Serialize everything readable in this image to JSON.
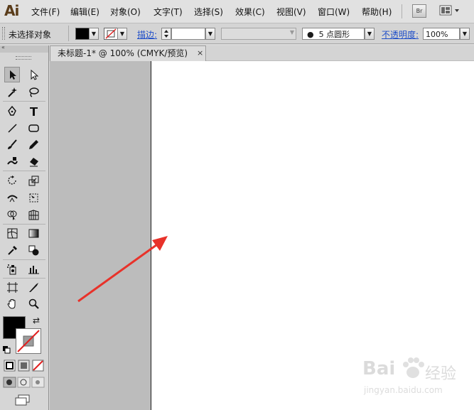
{
  "app": {
    "logo": "Ai"
  },
  "menu": {
    "items": [
      {
        "label": "文件(F)"
      },
      {
        "label": "编辑(E)"
      },
      {
        "label": "对象(O)"
      },
      {
        "label": "文字(T)"
      },
      {
        "label": "选择(S)"
      },
      {
        "label": "效果(C)"
      },
      {
        "label": "视图(V)"
      },
      {
        "label": "窗口(W)"
      },
      {
        "label": "帮助(H)"
      }
    ],
    "bridge_label": "Br"
  },
  "control": {
    "selection_status": "未选择对象",
    "stroke_label": "描边:",
    "brush_label": "5 点圆形",
    "opacity_label": "不透明度:",
    "opacity_value": "100%"
  },
  "document": {
    "tab_title": "未标题-1* @ 100% (CMYK/预览)",
    "close_glyph": "×"
  },
  "toolbox": {
    "collapse_glyph": "«"
  },
  "watermark": {
    "brand": "Bai",
    "brand2": "经验",
    "url": "jingyan.baidu.com"
  },
  "colors": {
    "annotation_arrow": "#e8322a",
    "fill_swatch": "#000000",
    "stroke_swatch": "#ffffff"
  }
}
